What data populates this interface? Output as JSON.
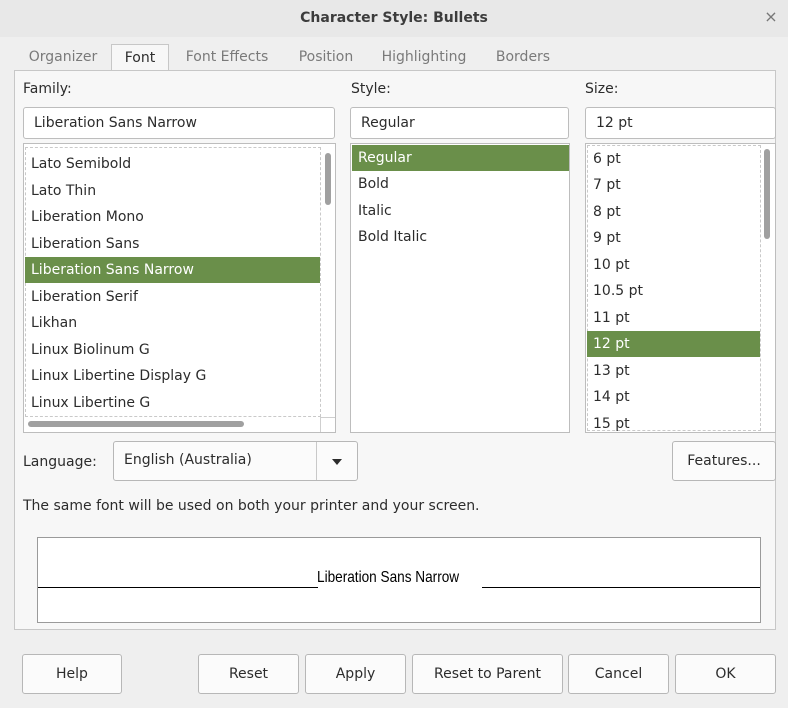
{
  "window": {
    "title": "Character Style: Bullets",
    "close_glyph": "×"
  },
  "tabs": [
    {
      "label": "Organizer"
    },
    {
      "label": "Font"
    },
    {
      "label": "Font Effects"
    },
    {
      "label": "Position"
    },
    {
      "label": "Highlighting"
    },
    {
      "label": "Borders"
    }
  ],
  "active_tab": "Font",
  "family": {
    "label": "Family:",
    "value": "Liberation Sans Narrow",
    "items": [
      "Lato Semibold",
      "Lato Thin",
      "Liberation Mono",
      "Liberation Sans",
      "Liberation Sans Narrow",
      "Liberation Serif",
      "Likhan",
      "Linux Biolinum G",
      "Linux Libertine Display G",
      "Linux Libertine G"
    ],
    "selected": "Liberation Sans Narrow"
  },
  "style": {
    "label": "Style:",
    "value": "Regular",
    "items": [
      "Regular",
      "Bold",
      "Italic",
      "Bold Italic"
    ],
    "selected": "Regular"
  },
  "size": {
    "label": "Size:",
    "value": "12 pt",
    "items": [
      "6 pt",
      "7 pt",
      "8 pt",
      "9 pt",
      "10 pt",
      "10.5 pt",
      "11 pt",
      "12 pt",
      "13 pt",
      "14 pt",
      "15 pt"
    ],
    "selected": "12 pt"
  },
  "language": {
    "label": "Language:",
    "value": "English (Australia)"
  },
  "features_button": "Features...",
  "info_text": "The same font will be used on both your printer and your screen.",
  "preview_text": "Liberation Sans Narrow",
  "buttons": {
    "help": "Help",
    "reset": "Reset",
    "apply": "Apply",
    "reset_to_parent": "Reset to Parent",
    "cancel": "Cancel",
    "ok": "OK"
  },
  "colors": {
    "selection": "#6a8f4a"
  }
}
